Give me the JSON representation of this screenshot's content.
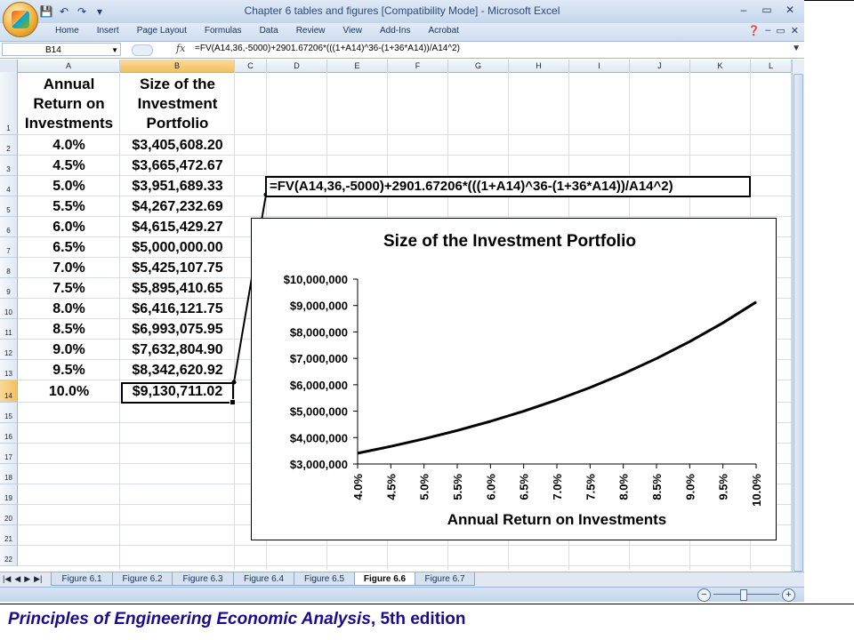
{
  "window": {
    "title": "Chapter 6 tables and figures  [Compatibility Mode] - Microsoft Excel",
    "controls": [
      "–",
      "▭",
      "✕"
    ],
    "help_icon": "help-icon"
  },
  "ribbon": {
    "tabs": [
      "Home",
      "Insert",
      "Page Layout",
      "Formulas",
      "Data",
      "Review",
      "View",
      "Add-Ins",
      "Acrobat"
    ]
  },
  "formula_bar": {
    "name_box": "B14",
    "fx": "fx",
    "formula": "=FV(A14,36,-5000)+2901.67206*(((1+A14)^36-(1+36*A14))/A14^2)"
  },
  "columns": [
    "A",
    "B",
    "C",
    "D",
    "E",
    "F",
    "G",
    "H",
    "I",
    "J",
    "K",
    "L"
  ],
  "rows": [
    "1",
    "2",
    "3",
    "4",
    "5",
    "6",
    "7",
    "8",
    "9",
    "10",
    "11",
    "12",
    "13",
    "14",
    "15",
    "16",
    "17",
    "18",
    "19",
    "20",
    "21",
    "22"
  ],
  "table": {
    "header_a": [
      "Annual",
      "Return on",
      "Investments"
    ],
    "header_b": [
      "Size of the",
      "Investment",
      "Portfolio"
    ],
    "rates": [
      "4.0%",
      "4.5%",
      "5.0%",
      "5.5%",
      "6.0%",
      "6.5%",
      "7.0%",
      "7.5%",
      "8.0%",
      "8.5%",
      "9.0%",
      "9.5%",
      "10.0%"
    ],
    "values": [
      "$3,405,608.20",
      "$3,665,472.67",
      "$3,951,689.33",
      "$4,267,232.69",
      "$4,615,429.27",
      "$5,000,000.00",
      "$5,425,107.75",
      "$5,895,410.65",
      "$6,416,121.75",
      "$6,993,075.95",
      "$7,632,804.90",
      "$8,342,620.92",
      "$9,130,711.02"
    ]
  },
  "callout": {
    "text": "=FV(A14,36,-5000)+2901.67206*(((1+A14)^36-(1+36*A14))/A14^2)"
  },
  "chart_data": {
    "type": "line",
    "title": "Size of the Investment Portfolio",
    "xlabel": "Annual Return on Investments",
    "ylabel": "",
    "categories": [
      "4.0%",
      "4.5%",
      "5.0%",
      "5.5%",
      "6.0%",
      "6.5%",
      "7.0%",
      "7.5%",
      "8.0%",
      "8.5%",
      "9.0%",
      "9.5%",
      "10.0%"
    ],
    "series": [
      {
        "values": [
          3405608.2,
          3665472.67,
          3951689.33,
          4267232.69,
          4615429.27,
          5000000.0,
          5425107.75,
          5895410.65,
          6416121.75,
          6993075.95,
          7632804.9,
          8342620.92,
          9130711.02
        ]
      }
    ],
    "yticks": [
      "$3,000,000",
      "$4,000,000",
      "$5,000,000",
      "$6,000,000",
      "$7,000,000",
      "$8,000,000",
      "$9,000,000",
      "$10,000,000"
    ],
    "ylim": [
      3000000,
      10000000
    ],
    "grid": false,
    "legend": "none"
  },
  "sheets": {
    "tabs": [
      "Figure 6.1",
      "Figure 6.2",
      "Figure 6.3",
      "Figure 6.4",
      "Figure 6.5",
      "Figure 6.6",
      "Figure 6.7"
    ],
    "active": "Figure 6.6",
    "nav": [
      "|◀",
      "◀",
      "▶",
      "▶|"
    ]
  },
  "status": {
    "zoom_minus": "−",
    "zoom_plus": "+"
  },
  "footer": {
    "title": "Principles of Engineering Economic Analysis",
    "edition": ", 5th edition"
  }
}
